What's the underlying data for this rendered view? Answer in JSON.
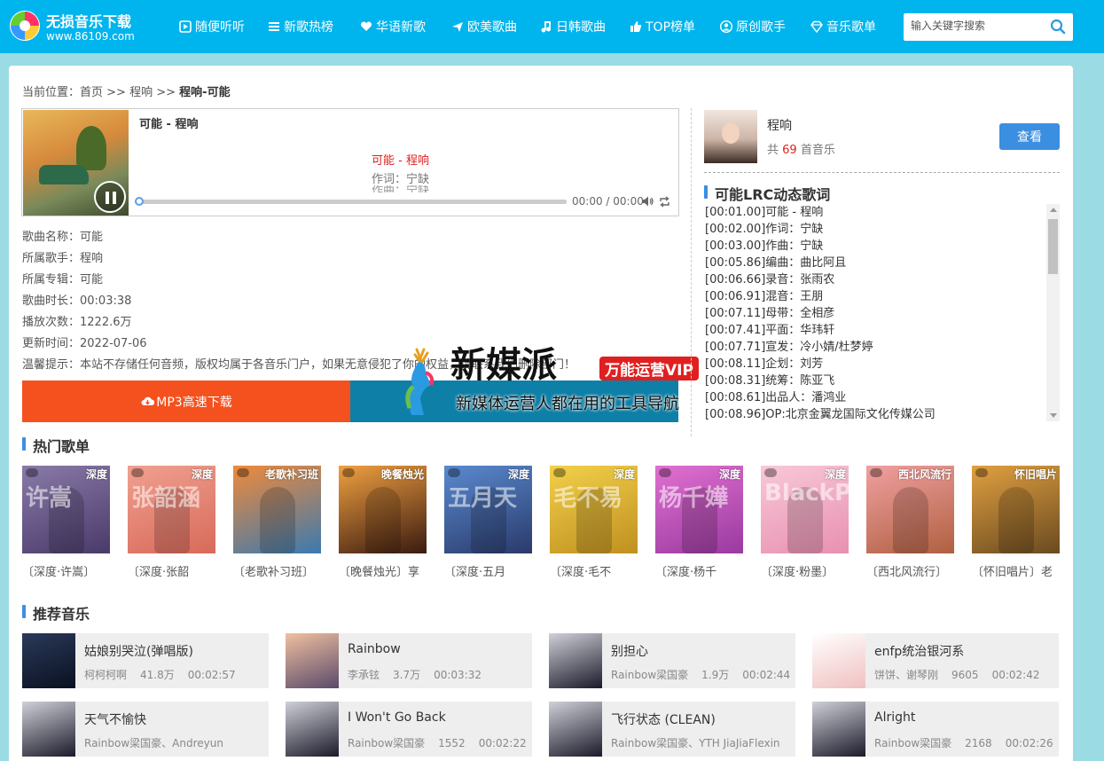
{
  "header": {
    "logo_title": "无损音乐下载",
    "logo_url": "www.86109.com",
    "nav": [
      {
        "label": "随便听听",
        "icon": "play-square-icon"
      },
      {
        "label": "新歌热榜",
        "icon": "list-icon"
      },
      {
        "label": "华语新歌",
        "icon": "heart-icon"
      },
      {
        "label": "欧美歌曲",
        "icon": "plane-icon"
      },
      {
        "label": "日韩歌曲",
        "icon": "music-note-icon"
      },
      {
        "label": "TOP榜单",
        "icon": "thumbs-up-icon"
      },
      {
        "label": "原创歌手",
        "icon": "user-circle-icon"
      },
      {
        "label": "音乐歌单",
        "icon": "diamond-icon"
      }
    ],
    "search_placeholder": "输入关键字搜索"
  },
  "breadcrumb": {
    "prefix": "当前位置：",
    "home": "首页",
    "sep1": " >> ",
    "artist": "程响",
    "sep2": " >> ",
    "current": "程响-可能"
  },
  "player": {
    "title": "可能 - 程响",
    "lyric_current": "可能 - 程响",
    "lyric_next": "作词：宁缺",
    "lyric_faded": "作曲：宁缺",
    "time": "00:00 / 00:00",
    "progress": 0
  },
  "song_info": [
    "歌曲名称：可能",
    "所属歌手：程响",
    "所属专辑：可能",
    "歌曲时长：00:03:38",
    "播放次数：1222.6万",
    "更新时间：2022-07-06",
    "温馨提示：本站不存储任何音频，版权均属于各音乐门户，如果无意侵犯了你的权益，请联系我们删除部门！"
  ],
  "download": {
    "mp3_label": "MP3高速下载"
  },
  "singer": {
    "name": "程响",
    "count_prefix": "共 ",
    "count": "69",
    "count_suffix": " 首音乐",
    "view_label": "查看"
  },
  "lrc": {
    "title": "可能LRC动态歌词",
    "lines": [
      "[00:01.00]可能 - 程响",
      "[00:02.00]作词：宁缺",
      "[00:03.00]作曲：宁缺",
      "[00:05.86]编曲：曲比阿且",
      "[00:06.66]录音：张雨农",
      "[00:06.91]混音：王朋",
      "[00:07.11]母带：全相彦",
      "[00:07.41]平面：华玮轩",
      "[00:07.71]宣发：冷小婧/杜梦婷",
      "[00:08.11]企划：刘芳",
      "[00:08.31]统筹：陈亚飞",
      "[00:08.61]出品人：潘鸿业",
      "[00:08.96]OP:北京金翼龙国际文化传媒公司"
    ]
  },
  "watermark": {
    "title": "新媒派",
    "badge": "万能运营VIP",
    "subtitle": "新媒体运营人都在用的工具导航"
  },
  "hot_playlists": {
    "title": "热门歌单",
    "items": [
      {
        "tag": "深度",
        "big": "许嵩",
        "caption": "〔深度·许嵩〕",
        "color1": "#8a7aa8",
        "color2": "#4a3a6a"
      },
      {
        "tag": "深度",
        "big": "张韶涵",
        "caption": "〔深度·张韶",
        "color1": "#f0a090",
        "color2": "#d86a5a"
      },
      {
        "tag": "老歌补习班",
        "big": "",
        "caption": "〔老歌补习班〕",
        "color1": "#f08a3a",
        "color2": "#3a7ab0"
      },
      {
        "tag": "晚餐烛光",
        "big": "",
        "caption": "〔晚餐烛光〕享",
        "color1": "#f0a040",
        "color2": "#3a1a10"
      },
      {
        "tag": "深度",
        "big": "五月天",
        "caption": "〔深度·五月",
        "color1": "#5a8ad0",
        "color2": "#2a3a6a"
      },
      {
        "tag": "深度",
        "big": "毛不易",
        "caption": "〔深度·毛不",
        "color1": "#f2d04a",
        "color2": "#c09020"
      },
      {
        "tag": "深度",
        "big": "杨千嬅",
        "caption": "〔深度·杨千",
        "color1": "#e070d0",
        "color2": "#9a3aa0"
      },
      {
        "tag": "深度",
        "big": "BlackPink",
        "caption": "〔深度·粉墨〕",
        "color1": "#f8c8d8",
        "color2": "#e890b0"
      },
      {
        "tag": "西北风流行",
        "big": "",
        "caption": "〔西北风流行〕",
        "color1": "#f0a0a0",
        "color2": "#b06040"
      },
      {
        "tag": "怀旧唱片",
        "big": "",
        "caption": "〔怀旧唱片〕老",
        "color1": "#e0a040",
        "color2": "#6a4a20"
      }
    ]
  },
  "recommend": {
    "title": "推荐音乐",
    "items": [
      {
        "name": "姑娘别哭泣(弹唱版)",
        "artist": "柯柯柯啊",
        "plays": "41.8万",
        "duration": "00:02:57",
        "color1": "#2a3a5a",
        "color2": "#0a1020"
      },
      {
        "name": "Rainbow",
        "artist": "李承铉",
        "plays": "3.7万",
        "duration": "00:03:32",
        "color1": "#f0c0a0",
        "color2": "#5a4a6a"
      },
      {
        "name": "别担心",
        "artist": "Rainbow梁国豪",
        "plays": "1.9万",
        "duration": "00:02:44",
        "color1": "#d0d0d8",
        "color2": "#1a1a2a"
      },
      {
        "name": "enfp统治银河系",
        "artist": "饼饼、谢琴刚",
        "plays": "9605",
        "duration": "00:02:42",
        "color1": "#ffffff",
        "color2": "#f0c0c0"
      },
      {
        "name": "天气不愉快",
        "artist": "Rainbow梁国豪、Andreyun",
        "plays": "",
        "duration": "",
        "color1": "#d0d0d8",
        "color2": "#1a1a2a"
      },
      {
        "name": "I Won't Go Back",
        "artist": "Rainbow梁国豪",
        "plays": "1552",
        "duration": "00:02:22",
        "color1": "#d0d0d8",
        "color2": "#1a1a2a"
      },
      {
        "name": "飞行状态 (CLEAN)",
        "artist": "Rainbow梁国豪、YTH JiaJiaFlexin",
        "plays": "",
        "duration": "",
        "color1": "#d0d0d8",
        "color2": "#1a1a2a"
      },
      {
        "name": "Alright",
        "artist": "Rainbow梁国豪",
        "plays": "2168",
        "duration": "00:02:26",
        "color1": "#d0d0d8",
        "color2": "#1a1a2a"
      }
    ]
  },
  "colors": {
    "header": "#00b4ee",
    "page_bg": "#9bdbe4",
    "download": "#f4511e",
    "accent": "#3b8fe0",
    "highlight": "#e02020"
  }
}
